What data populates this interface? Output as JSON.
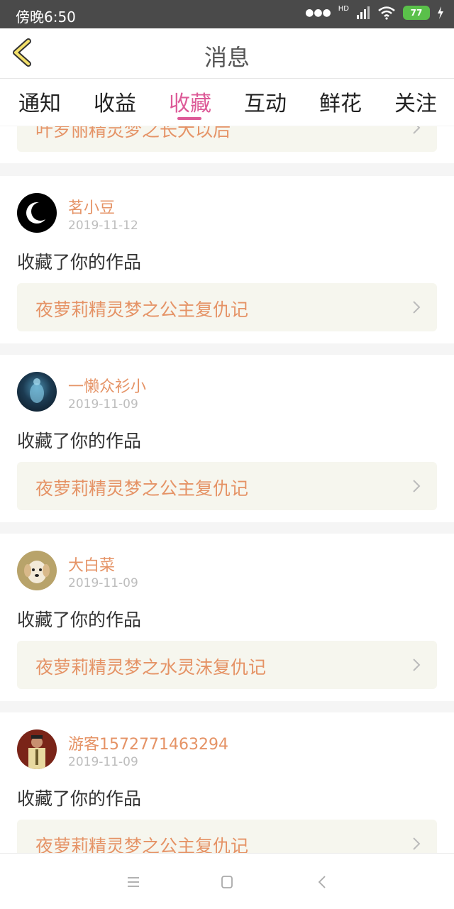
{
  "status_bar": {
    "time": "傍晚6:50",
    "hd": "HD",
    "battery": "77"
  },
  "header": {
    "title": "消息"
  },
  "tabs": [
    {
      "label": "通知"
    },
    {
      "label": "收益"
    },
    {
      "label": "收藏"
    },
    {
      "label": "互动"
    },
    {
      "label": "鲜花"
    },
    {
      "label": "关注"
    }
  ],
  "partial_item": {
    "work_title": "叶罗丽精灵梦之长大以后"
  },
  "items": [
    {
      "username": "茗小豆",
      "date": "2019-11-12",
      "action": "收藏了你的作品",
      "work_title": "夜萝莉精灵梦之公主复仇记"
    },
    {
      "username": "一懒众衫小",
      "date": "2019-11-09",
      "action": "收藏了你的作品",
      "work_title": "夜萝莉精灵梦之公主复仇记"
    },
    {
      "username": "大白菜",
      "date": "2019-11-09",
      "action": "收藏了你的作品",
      "work_title": "夜萝莉精灵梦之水灵沫复仇记"
    },
    {
      "username": "游客1572771463294",
      "date": "2019-11-09",
      "action": "收藏了你的作品",
      "work_title": "夜萝莉精灵梦之公主复仇记"
    }
  ],
  "colors": {
    "accent": "#dd5b98",
    "username": "#e59366",
    "work_bg": "#f6f6ee"
  }
}
